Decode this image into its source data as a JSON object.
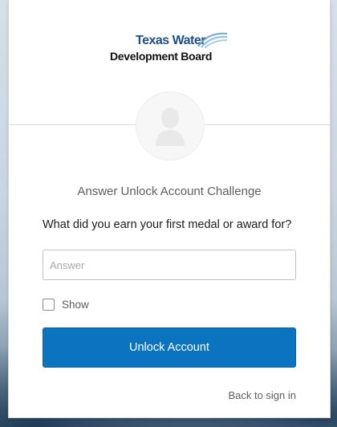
{
  "logo": {
    "line1": "Texas Water",
    "line2": "Development Board",
    "icon": "water-waves-icon"
  },
  "avatar": {
    "icon": "user-silhouette-icon"
  },
  "challenge": {
    "title": "Answer Unlock Account Challenge",
    "question": "What did you earn your first medal or award for?",
    "answer_placeholder": "Answer",
    "answer_value": "",
    "show_label": "Show",
    "show_checked": false
  },
  "actions": {
    "unlock_label": "Unlock Account",
    "back_label": "Back to sign in"
  },
  "colors": {
    "primary_button": "#0a74c0",
    "logo_blue": "#1f4e8c"
  }
}
